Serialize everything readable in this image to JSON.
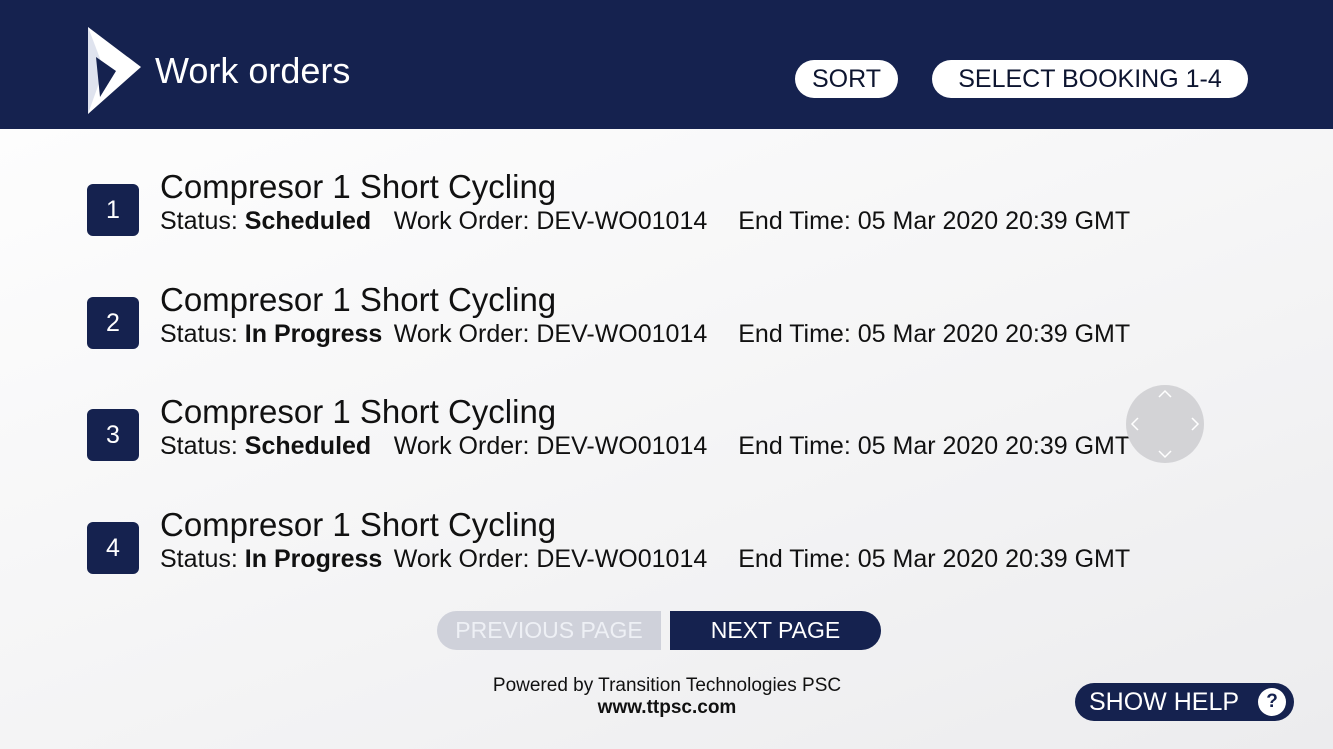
{
  "header": {
    "title": "Work orders",
    "logo_icon": "dynamics-logo-icon",
    "sort_label": "SORT",
    "select_label": "SELECT BOOKING 1-4",
    "background_color": "#15224f"
  },
  "work_orders": [
    {
      "number": "1",
      "title": "Compresor 1 Short Cycling",
      "status_label": "Status:",
      "status": "Scheduled",
      "work_order_label": "Work Order:",
      "work_order": "DEV-WO01014",
      "end_time_label": "End Time:",
      "end_time": "05 Mar 2020 20:39 GMT"
    },
    {
      "number": "2",
      "title": "Compresor 1 Short Cycling",
      "status_label": "Status:",
      "status": "In Progress",
      "work_order_label": "Work Order:",
      "work_order": "DEV-WO01014",
      "end_time_label": "End Time:",
      "end_time": "05 Mar 2020 20:39 GMT"
    },
    {
      "number": "3",
      "title": "Compresor 1 Short Cycling",
      "status_label": "Status:",
      "status": "Scheduled",
      "work_order_label": "Work Order:",
      "work_order": "DEV-WO01014",
      "end_time_label": "End Time:",
      "end_time": "05 Mar 2020 20:39 GMT"
    },
    {
      "number": "4",
      "title": "Compresor 1 Short Cycling",
      "status_label": "Status:",
      "status": "In Progress",
      "work_order_label": "Work Order:",
      "work_order": "DEV-WO01014",
      "end_time_label": "End Time:",
      "end_time": "05 Mar 2020 20:39 GMT"
    }
  ],
  "pagination": {
    "previous_label": "PREVIOUS PAGE",
    "next_label": "NEXT PAGE"
  },
  "footer": {
    "powered_by": "Powered by Transition Technologies PSC",
    "website": "www.ttpsc.com"
  },
  "help": {
    "label": "SHOW HELP",
    "icon": "?"
  }
}
